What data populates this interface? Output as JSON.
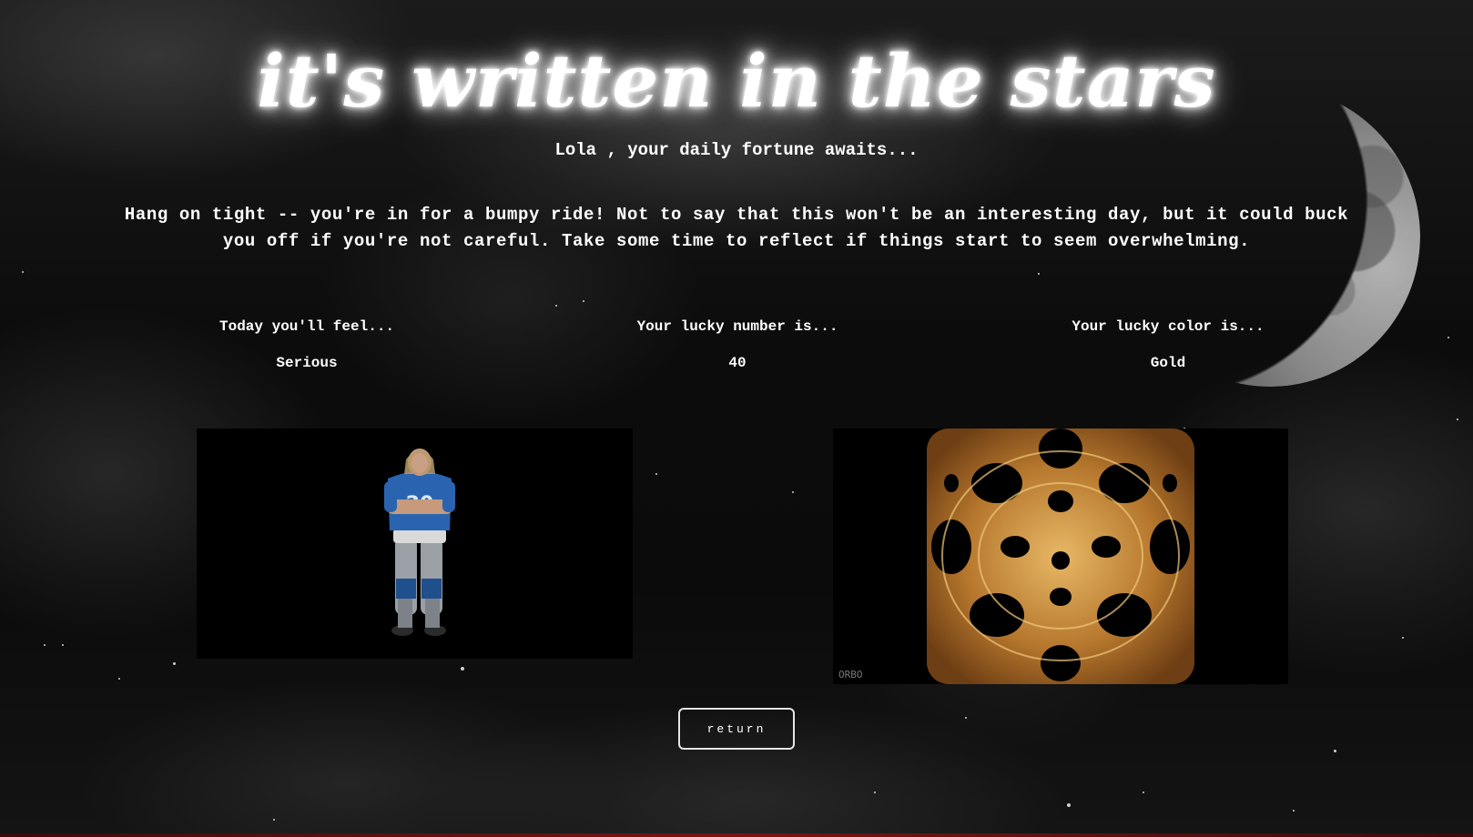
{
  "header": {
    "title": "it's written in the stars",
    "greeting": "Lola , your daily fortune awaits..."
  },
  "fortune": {
    "text": "Hang on tight -- you're in for a bumpy ride! Not to say that this won't be an interesting day, but it could buck you off if you're not careful. Take some time to reflect if things start to seem overwhelming."
  },
  "stats": {
    "mood": {
      "label": "Today you'll feel...",
      "value": "Serious"
    },
    "number": {
      "label": "Your lucky number is...",
      "value": "40"
    },
    "color": {
      "label": "Your lucky color is...",
      "value": "Gold"
    }
  },
  "gifs": {
    "mood_caption": "",
    "color_watermark": "ORBO"
  },
  "actions": {
    "return_label": "return"
  },
  "colors": {
    "background": "#0b0b0b",
    "text": "#ffffff",
    "gold": "#c8923c",
    "jersey_blue": "#2a64b0"
  }
}
